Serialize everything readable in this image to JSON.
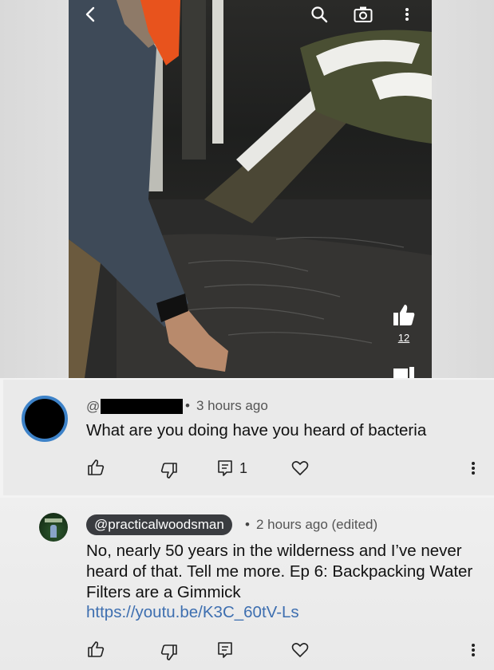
{
  "video": {
    "like_count": "12",
    "icons": [
      "back-chevron-icon",
      "search-icon",
      "camera-icon",
      "more-vertical-icon",
      "thumbs-up-icon"
    ]
  },
  "comments": [
    {
      "at": "@",
      "author_redacted": true,
      "separator": "•",
      "time": "3 hours ago",
      "text": "What are you doing have you heard of bacteria",
      "reply_count": "1"
    },
    {
      "author": "@practicalwoodsman",
      "separator": "•",
      "time": "2 hours ago (edited)",
      "text": "No, nearly 50 years in the wilderness and I’ve never heard of that. Tell me more. Ep 6: Backpacking Water Filters are a Gimmick",
      "link": "https://youtu.be/K3C_60tV-Ls"
    }
  ],
  "colors": {
    "avatar_ring": "#3d82c8",
    "handle_badge": "#3a3c40",
    "link": "#3e6fb0"
  }
}
